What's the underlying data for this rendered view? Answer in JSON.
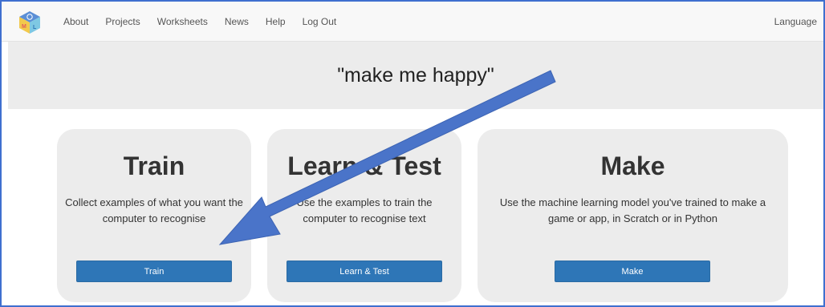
{
  "nav": {
    "links": [
      "About",
      "Projects",
      "Worksheets",
      "News",
      "Help",
      "Log Out"
    ],
    "language": "Language"
  },
  "banner": {
    "title": "\"make me happy\""
  },
  "cards": {
    "train": {
      "title": "Train",
      "description": "Collect examples of what you want the computer to recognise",
      "button": "Train"
    },
    "learn": {
      "title": "Learn & Test",
      "description": "Use the examples to train the computer to recognise text",
      "button": "Learn & Test"
    },
    "make": {
      "title": "Make",
      "description": "Use the machine learning model you've trained to make a game or app, in Scratch or in Python",
      "button": "Make"
    }
  },
  "colors": {
    "accent": "#2e76b7",
    "annotation_arrow": "#4a74c9",
    "frame_border": "#3f6fcf"
  }
}
